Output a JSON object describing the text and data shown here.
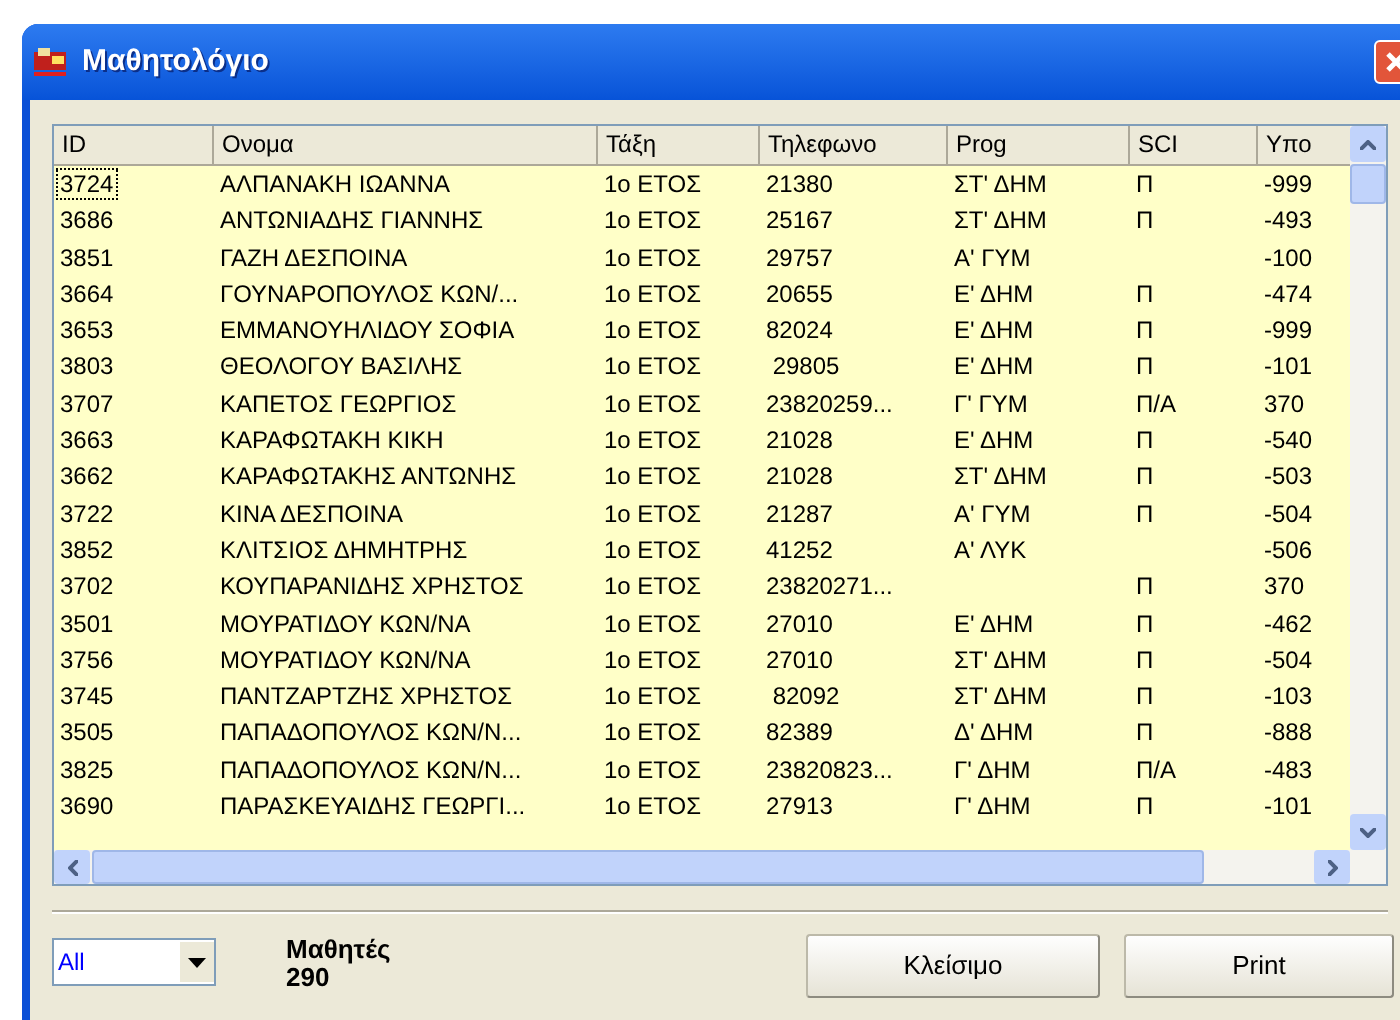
{
  "window": {
    "title": "Μαθητολόγιο"
  },
  "table": {
    "columns": [
      "ID",
      "Ονομα",
      "Τάξη",
      "Τηλεφωνο",
      "Prog",
      "SCI",
      "Υπο"
    ],
    "rows": [
      {
        "cells": [
          "3724",
          "ΑΛΠΑΝΑΚΗ ΙΩΑΝΝΑ",
          "1ο ΕΤΟΣ",
          "21380",
          "ΣΤ' ΔΗΜ",
          "Π",
          "-999"
        ],
        "focused": true
      },
      {
        "cells": [
          "3686",
          "ΑΝΤΩΝΙΑΔΗΣ ΓΙΑΝΝΗΣ",
          "1ο ΕΤΟΣ",
          "25167",
          "ΣΤ' ΔΗΜ",
          "Π",
          "-493"
        ],
        "focused": false
      },
      {
        "cells": [
          "3851",
          "ΓΑΖΗ ΔΕΣΠΟΙΝΑ",
          "1ο ΕΤΟΣ",
          "29757",
          "Α' ΓΥΜ",
          "",
          "-100"
        ],
        "focused": false
      },
      {
        "cells": [
          "3664",
          "ΓΟΥΝΑΡΟΠΟΥΛΟΣ ΚΩΝ/...",
          "1ο ΕΤΟΣ",
          "20655",
          "Ε' ΔΗΜ",
          "Π",
          "-474"
        ],
        "focused": false
      },
      {
        "cells": [
          "3653",
          "ΕΜΜΑΝΟΥΗΛΙΔΟΥ ΣΟΦΙΑ",
          "1ο ΕΤΟΣ",
          "82024",
          "Ε' ΔΗΜ",
          "Π",
          "-999"
        ],
        "focused": false
      },
      {
        "cells": [
          "3803",
          "ΘΕΟΛΟΓΟΥ ΒΑΣΙΛΗΣ",
          "1ο ΕΤΟΣ",
          " 29805",
          "Ε' ΔΗΜ",
          "Π",
          "-101"
        ],
        "focused": false
      },
      {
        "cells": [
          "3707",
          "ΚΑΠΕΤΟΣ ΓΕΩΡΓΙΟΣ",
          "1ο ΕΤΟΣ",
          "23820259...",
          "Γ' ΓΥΜ",
          "Π/Α",
          "370"
        ],
        "focused": false
      },
      {
        "cells": [
          "3663",
          "ΚΑΡΑΦΩΤΑΚΗ ΚΙΚΗ",
          "1ο ΕΤΟΣ",
          "21028",
          "Ε' ΔΗΜ",
          "Π",
          "-540"
        ],
        "focused": false
      },
      {
        "cells": [
          "3662",
          "ΚΑΡΑΦΩΤΑΚΗΣ ΑΝΤΩΝΗΣ",
          "1ο ΕΤΟΣ",
          "21028",
          "ΣΤ' ΔΗΜ",
          "Π",
          "-503"
        ],
        "focused": false
      },
      {
        "cells": [
          "3722",
          "ΚΙΝΑ ΔΕΣΠΟΙΝΑ",
          "1ο ΕΤΟΣ",
          "21287",
          "Α' ΓΥΜ",
          "Π",
          "-504"
        ],
        "focused": false
      },
      {
        "cells": [
          "3852",
          "ΚΛΙΤΣΙΟΣ ΔΗΜΗΤΡΗΣ",
          "1ο ΕΤΟΣ",
          "41252",
          "Α' ΛΥΚ",
          "",
          "-506"
        ],
        "focused": false
      },
      {
        "cells": [
          "3702",
          "ΚΟΥΠΑΡΑΝΙΔΗΣ ΧΡΗΣΤΟΣ",
          "1ο ΕΤΟΣ",
          "23820271...",
          "",
          "Π",
          "370"
        ],
        "focused": false
      },
      {
        "cells": [
          "3501",
          "ΜΟΥΡΑΤΙΔΟΥ ΚΩΝ/ΝΑ",
          "1ο ΕΤΟΣ",
          "27010",
          "Ε' ΔΗΜ",
          "Π",
          "-462"
        ],
        "focused": false
      },
      {
        "cells": [
          "3756",
          "ΜΟΥΡΑΤΙΔΟΥ ΚΩΝ/ΝΑ",
          "1ο ΕΤΟΣ",
          "27010",
          "ΣΤ' ΔΗΜ",
          "Π",
          "-504"
        ],
        "focused": false
      },
      {
        "cells": [
          "3745",
          "ΠΑΝΤΖΑΡΤΖΗΣ ΧΡΗΣΤΟΣ",
          "1ο ΕΤΟΣ",
          " 82092",
          "ΣΤ' ΔΗΜ",
          "Π",
          "-103"
        ],
        "focused": false
      },
      {
        "cells": [
          "3505",
          "ΠΑΠΑΔΟΠΟΥΛΟΣ ΚΩΝ/Ν...",
          "1ο ΕΤΟΣ",
          "82389",
          "Δ' ΔΗΜ",
          "Π",
          "-888"
        ],
        "focused": false
      },
      {
        "cells": [
          "3825",
          "ΠΑΠΑΔΟΠΟΥΛΟΣ ΚΩΝ/Ν...",
          "1ο ΕΤΟΣ",
          "23820823...",
          "Γ' ΔΗΜ",
          "Π/Α",
          "-483"
        ],
        "focused": false
      },
      {
        "cells": [
          "3690",
          "ΠΑΡΑΣΚΕΥΑΙΔΗΣ ΓΕΩΡΓΙ...",
          "1ο ΕΤΟΣ",
          "27913",
          "Γ' ΔΗΜ",
          "Π",
          "-101"
        ],
        "focused": false
      }
    ]
  },
  "filter": {
    "value": "All"
  },
  "count": {
    "label": "Μαθητές",
    "value": "290"
  },
  "buttons": [
    "Κλείσιμο",
    "Print"
  ]
}
